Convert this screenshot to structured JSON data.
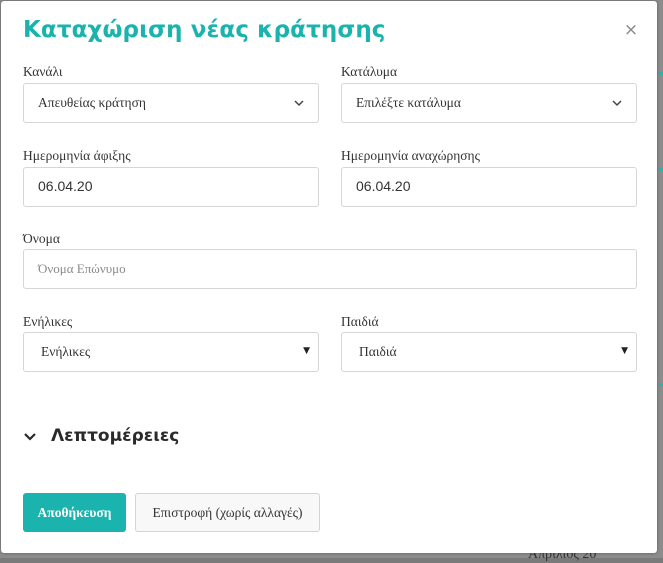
{
  "modal": {
    "title": "Καταχώριση νέας κράτησης",
    "close_symbol": "×"
  },
  "form": {
    "channel": {
      "label": "Κανάλι",
      "selected": "Απευθείας κράτηση",
      "icon": "chevron-down-icon"
    },
    "property": {
      "label": "Κατάλυμα",
      "selected": "Επιλέξτε κατάλυμα",
      "icon": "chevron-down-icon"
    },
    "arrival_date": {
      "label": "Ημερομηνία άφιξης",
      "value": "06.04.20"
    },
    "departure_date": {
      "label": "Ημερομηνία αναχώρησης",
      "value": "06.04.20"
    },
    "name": {
      "label": "Όνομα",
      "placeholder": "Όνομα Επώνυμο",
      "value": ""
    },
    "adults": {
      "label": "Ενήλικες",
      "selected": "Ενήλικες",
      "caret": "▼"
    },
    "children": {
      "label": "Παιδιά",
      "selected": "Παιδιά",
      "caret": "▼"
    }
  },
  "details": {
    "label": "Λεπτομέρειες",
    "icon": "chevron-down-icon"
  },
  "actions": {
    "save_label": "Αποθήκευση",
    "cancel_label": "Επιστροφή (χωρίς αλλαγές)"
  },
  "background": {
    "peek_text": "Απρίλιος 20"
  },
  "colors": {
    "accent": "#1ab3ad",
    "overlay": "#8c8c8c"
  }
}
